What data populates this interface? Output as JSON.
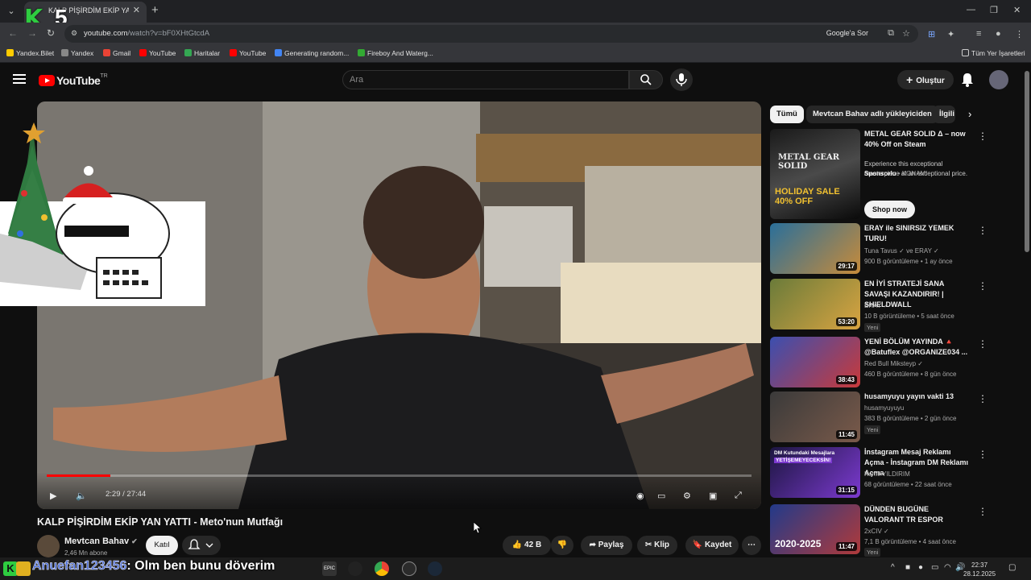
{
  "browser": {
    "tab_title": "KALP PİŞİRDİM EKİP YAN YATTI",
    "url_host": "youtube.com",
    "url_path": "/watch?v=bF0XHtGtcdA",
    "google_sor": "Google'a Sor",
    "bookmarks": [
      {
        "label": "Yandex.Bilet",
        "color": "#ffcc00"
      },
      {
        "label": "Yandex",
        "color": "#888888"
      },
      {
        "label": "Gmail",
        "color": "#ea4335"
      },
      {
        "label": "YouTube",
        "color": "#ff0000"
      },
      {
        "label": "Haritalar",
        "color": "#34a853"
      },
      {
        "label": "YouTube",
        "color": "#ff0000"
      },
      {
        "label": "Generating random...",
        "color": "#4285f4"
      },
      {
        "label": "Fireboy And Waterg...",
        "color": "#33aa33"
      }
    ],
    "all_bookmarks": "Tüm Yer İşaretleri"
  },
  "header": {
    "logo_text": "YouTube",
    "logo_country": "TR",
    "search_placeholder": "Ara",
    "create_label": "Oluştur"
  },
  "player": {
    "current_time": "2:29",
    "duration": "27:44",
    "progress_fraction": 0.09
  },
  "video": {
    "title": "KALP PİŞİRDİM EKİP YAN YATTI - Meto'nun Mutfağı",
    "channel": "Mevtcan Bahav",
    "subscribers": "2,46 Mn abone",
    "join_label": "Katıl",
    "likes": "42 B",
    "share_label": "Paylaş",
    "clip_label": "Klip",
    "save_label": "Kaydet"
  },
  "chips": [
    {
      "label": "Tümü",
      "active": true
    },
    {
      "label": "Mevtcan Bahav adlı yükleyiciden",
      "active": false
    },
    {
      "label": "İlgili",
      "active": false
    }
  ],
  "sidebar": {
    "ad": {
      "title": "METAL GEAR SOLID Δ – now 40% Off on Steam",
      "desc": "Experience this exceptional masterpiece at an exceptional price.",
      "sponsor": "Sponsorlu",
      "advertiser": "KONAMI",
      "cta": "Shop now",
      "thumb_text": "METAL GEAR SOLID",
      "sale_text": "HOLIDAY SALE 40% OFF"
    },
    "items": [
      {
        "title": "ERAY ile SINIRSIZ YEMEK TURU!",
        "channel": "Tuna Tavus ✓ ve ERAY ✓",
        "meta": "900 B görüntüleme • 1 ay önce",
        "duration": "29:17",
        "new": "",
        "c1": "#2a6f9a",
        "c2": "#c78b3a"
      },
      {
        "title": "EN İYİ STRATEJİ SANA SAVAŞI KAZANDIRIR! | SHIELDWALL",
        "channel": "ERAY ✓",
        "meta": "10 B görüntüleme • 5 saat önce",
        "duration": "53:20",
        "new": "Yeni",
        "c1": "#6a7b3a",
        "c2": "#d9a441"
      },
      {
        "title": "YENİ BÖLÜM YAYINDA 🔺 @Batuflex @ORGANIZE034 ...",
        "channel": "Red Bull Miksteyp ✓",
        "meta": "460 B görüntüleme • 8 gün önce",
        "duration": "38:43",
        "new": "",
        "c1": "#3b4fb0",
        "c2": "#c93a3a"
      },
      {
        "title": "husamyuyu yayın vakti 13",
        "channel": "husamyuyuyu",
        "meta": "383 B görüntüleme • 2 gün önce",
        "duration": "11:45",
        "new": "Yeni",
        "c1": "#3a3a3a",
        "c2": "#7a5a4a"
      },
      {
        "title": "İnstagram Mesaj Reklamı Açma - İnstagram DM Reklamı Açma",
        "channel": "Kamil YILDIRIM",
        "meta": "68 görüntüleme • 22 saat önce",
        "duration": "31:15",
        "new": "",
        "c1": "#1c1640",
        "c2": "#7c3ad0"
      },
      {
        "title": "DÜNDEN BUGÜNE VALORANT TR ESPOR",
        "channel": "2xCIV ✓",
        "meta": "7,1 B görüntüleme • 4 saat önce",
        "duration": "11:47",
        "new": "Yeni",
        "c1": "#223a8a",
        "c2": "#b03a3a"
      }
    ]
  },
  "overlay": {
    "chat_user": "Anuefan123456",
    "chat_message": ": Olm ben bunu döverim",
    "brand_letter": "K",
    "brand_number": "5"
  },
  "taskbar": {
    "time": "22:37",
    "date": "28.12.2025"
  },
  "thumb_overlay": {
    "item5_top": "DM Kutundaki Mesajlara",
    "item5_sub": "YETİŞEMEYECEKSİN!",
    "item6_year": "2020-2025"
  },
  "colors": {
    "accent": "#ff0000",
    "bg": "#0f0f0f",
    "chip_bg": "#272727"
  }
}
